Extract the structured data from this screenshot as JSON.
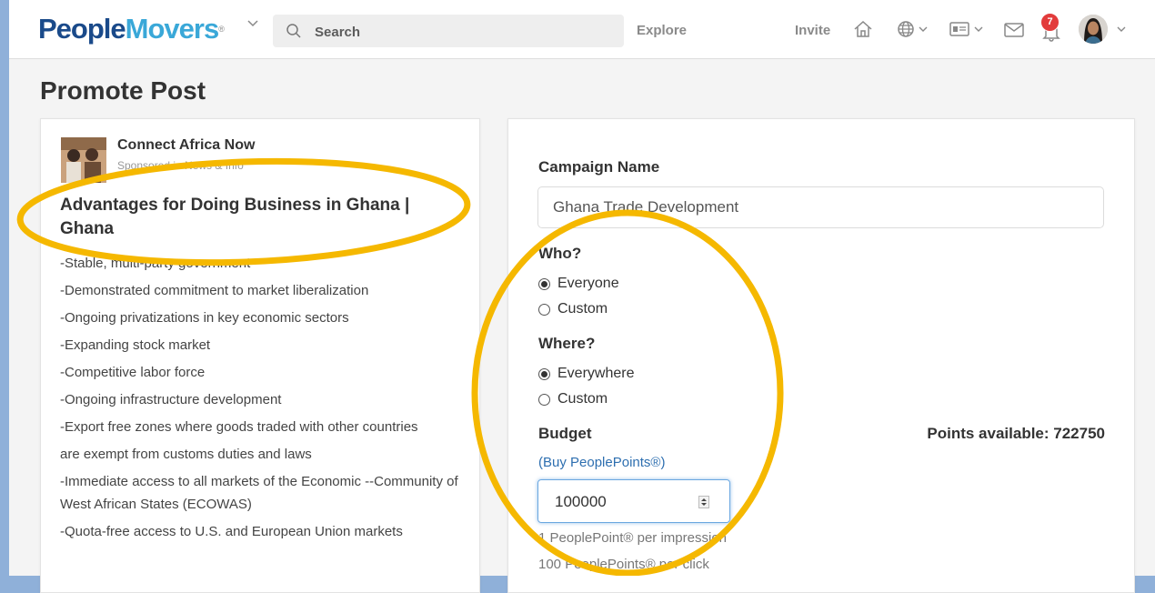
{
  "header": {
    "logo_part1": "People",
    "logo_part2": "Movers",
    "logo_mark": "®",
    "search_placeholder": "Search",
    "explore": "Explore",
    "invite": "Invite",
    "notification_count": "7"
  },
  "page": {
    "title": "Promote Post"
  },
  "post": {
    "author": "Connect Africa Now",
    "sponsored": "Sponsored in News & Info",
    "title": "Advantages for Doing Business in Ghana | Ghana",
    "lines": [
      "-Stable, multi-party government",
      "-Demonstrated commitment to market liberalization",
      "-Ongoing privatizations in key economic sectors",
      "-Expanding stock market",
      "-Competitive labor force",
      "-Ongoing infrastructure development",
      "-Export free zones where goods traded with other countries",
      "are exempt from customs duties and laws",
      "-Immediate access to all markets of the Economic --Community of West African States (ECOWAS)",
      "-Quota-free access to U.S. and European Union markets"
    ]
  },
  "form": {
    "campaign_label": "Campaign Name",
    "campaign_value": "Ghana Trade Development",
    "who_label": "Who?",
    "who_options": [
      "Everyone",
      "Custom"
    ],
    "who_selected": "Everyone",
    "where_label": "Where?",
    "where_options": [
      "Everywhere",
      "Custom"
    ],
    "where_selected": "Everywhere",
    "budget_label": "Budget",
    "points_available": "Points available: 722750",
    "buy_link": "(Buy PeoplePoints®)",
    "budget_value": "100000",
    "rate_impression": "1 PeoplePoint® per impression",
    "rate_click": "100 PeoplePoints® per click"
  },
  "colors": {
    "highlight": "#f5b800",
    "logo_dark": "#1a4a8a",
    "logo_light": "#3aa8d8",
    "link": "#2e6fb0",
    "badge": "#e23b3b"
  }
}
